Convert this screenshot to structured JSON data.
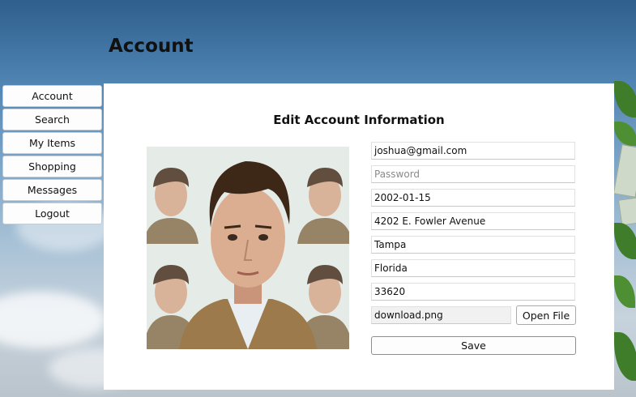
{
  "page": {
    "title": "Account"
  },
  "sidebar": {
    "items": [
      {
        "label": "Account"
      },
      {
        "label": "Search"
      },
      {
        "label": "My Items"
      },
      {
        "label": "Shopping"
      },
      {
        "label": "Messages"
      },
      {
        "label": "Logout"
      }
    ]
  },
  "form": {
    "heading": "Edit Account Information",
    "email": "joshua@gmail.com",
    "password_placeholder": "Password",
    "birthdate": "2002-01-15",
    "address": "4202 E. Fowler Avenue",
    "city": "Tampa",
    "state": "Florida",
    "zip": "33620",
    "file_name": "download.png",
    "open_file_label": "Open File",
    "save_label": "Save"
  }
}
